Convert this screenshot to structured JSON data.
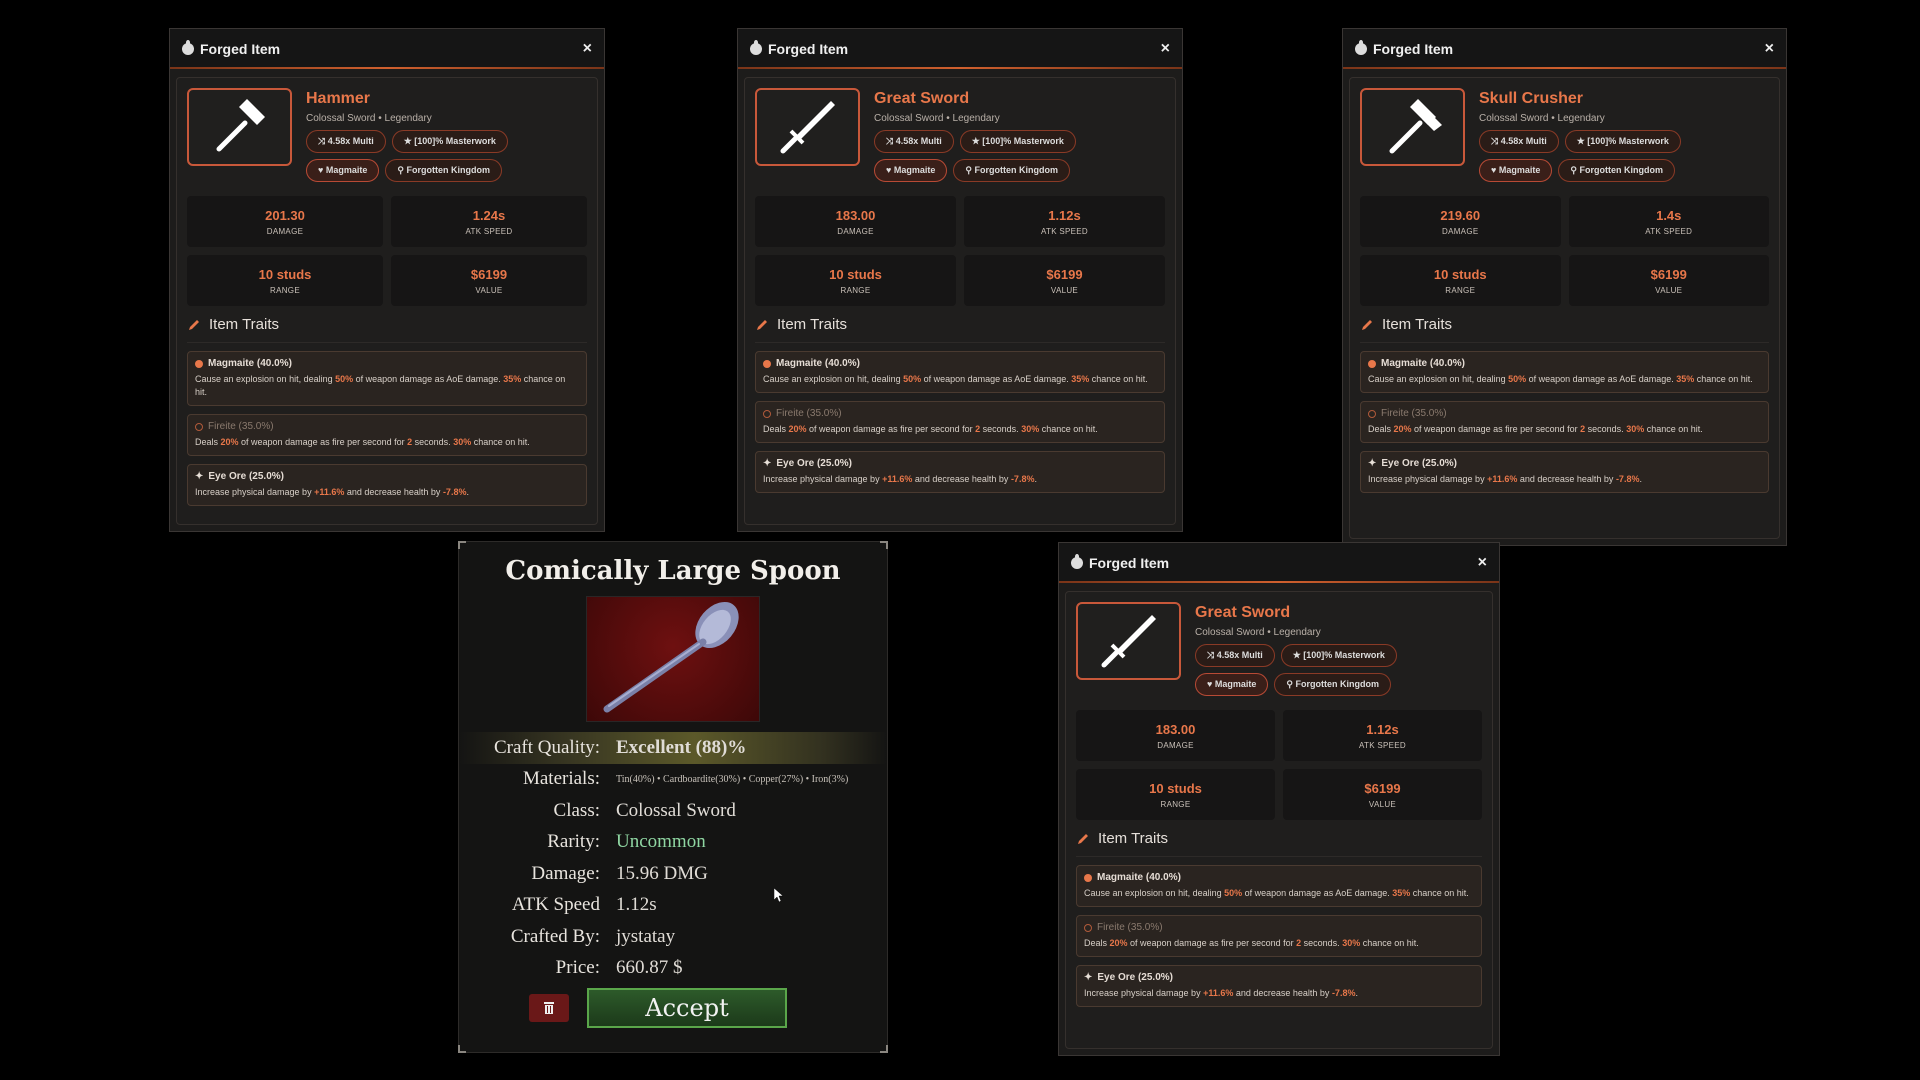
{
  "window_title": "Forged Item",
  "close_symbol": "×",
  "label_damage": "DAMAGE",
  "label_atk_speed": "ATK SPEED",
  "label_range": "RANGE",
  "label_value": "VALUE",
  "traits_title": "Item Traits",
  "trait_common": {
    "magmaite_name": "Magmaite (40.0%)",
    "magmaite_a": "Cause an explosion on hit, dealing ",
    "magmaite_pct1": "50%",
    "magmaite_b": " of weapon damage as AoE damage. ",
    "magmaite_pct2": "35%",
    "magmaite_c": " chance on hit.",
    "fireite_name": "Fireite (35.0%)",
    "fireite_a": "Deals ",
    "fireite_pct1": "20%",
    "fireite_b": " of weapon damage as fire per second for ",
    "fireite_n": "2",
    "fireite_c": " seconds. ",
    "fireite_pct2": "30%",
    "fireite_d": " chance on hit.",
    "eyeore_name": "Eye Ore (25.0%)",
    "eyeore_a": "Increase physical damage by ",
    "eyeore_pct1": "+11.6%",
    "eyeore_b": " and decrease health by ",
    "eyeore_pct2": "-7.8%",
    "eyeore_c": "."
  },
  "panels": [
    {
      "name": "Hammer",
      "sub": "Colossal Sword • Legendary",
      "multi": "4.58x Multi",
      "masterwork": "[100]% Masterwork",
      "material": "Magmaite",
      "origin": "Forgotten Kingdom",
      "damage": "201.30",
      "atk_speed": "1.24s",
      "range": "10 studs",
      "value": "$6199",
      "icon": "hammer-icon"
    },
    {
      "name": "Great Sword",
      "sub": "Colossal Sword • Legendary",
      "multi": "4.58x Multi",
      "masterwork": "[100]% Masterwork",
      "material": "Magmaite",
      "origin": "Forgotten Kingdom",
      "damage": "183.00",
      "atk_speed": "1.12s",
      "range": "10 studs",
      "value": "$6199",
      "icon": "sword-icon"
    },
    {
      "name": "Skull Crusher",
      "sub": "Colossal Sword • Legendary",
      "multi": "4.58x Multi",
      "masterwork": "[100]% Masterwork",
      "material": "Magmaite",
      "origin": "Forgotten Kingdom",
      "damage": "219.60",
      "atk_speed": "1.4s",
      "range": "10 studs",
      "value": "$6199",
      "icon": "double-hammer-icon"
    },
    {
      "name": "Great Sword",
      "sub": "Colossal Sword • Legendary",
      "multi": "4.58x Multi",
      "masterwork": "[100]% Masterwork",
      "material": "Magmaite",
      "origin": "Forgotten Kingdom",
      "damage": "183.00",
      "atk_speed": "1.12s",
      "range": "10 studs",
      "value": "$6199",
      "icon": "sword-icon"
    }
  ],
  "spoon": {
    "title": "Comically Large Spoon",
    "quality_label": "Craft Quality:",
    "quality_value": "Excellent (88)%",
    "materials_label": "Materials:",
    "materials_value": "Tin(40%) • Cardboardite(30%) • Copper(27%) • Iron(3%)",
    "class_label": "Class:",
    "class_value": "Colossal Sword",
    "rarity_label": "Rarity:",
    "rarity_value": "Uncommon",
    "damage_label": "Damage:",
    "damage_value": "15.96 DMG",
    "atk_label": "ATK Speed",
    "atk_value": "1.12s",
    "crafted_label": "Crafted By:",
    "crafted_value": "jystatay",
    "price_label": "Price:",
    "price_value": "660.87 $",
    "accept_label": "Accept"
  }
}
